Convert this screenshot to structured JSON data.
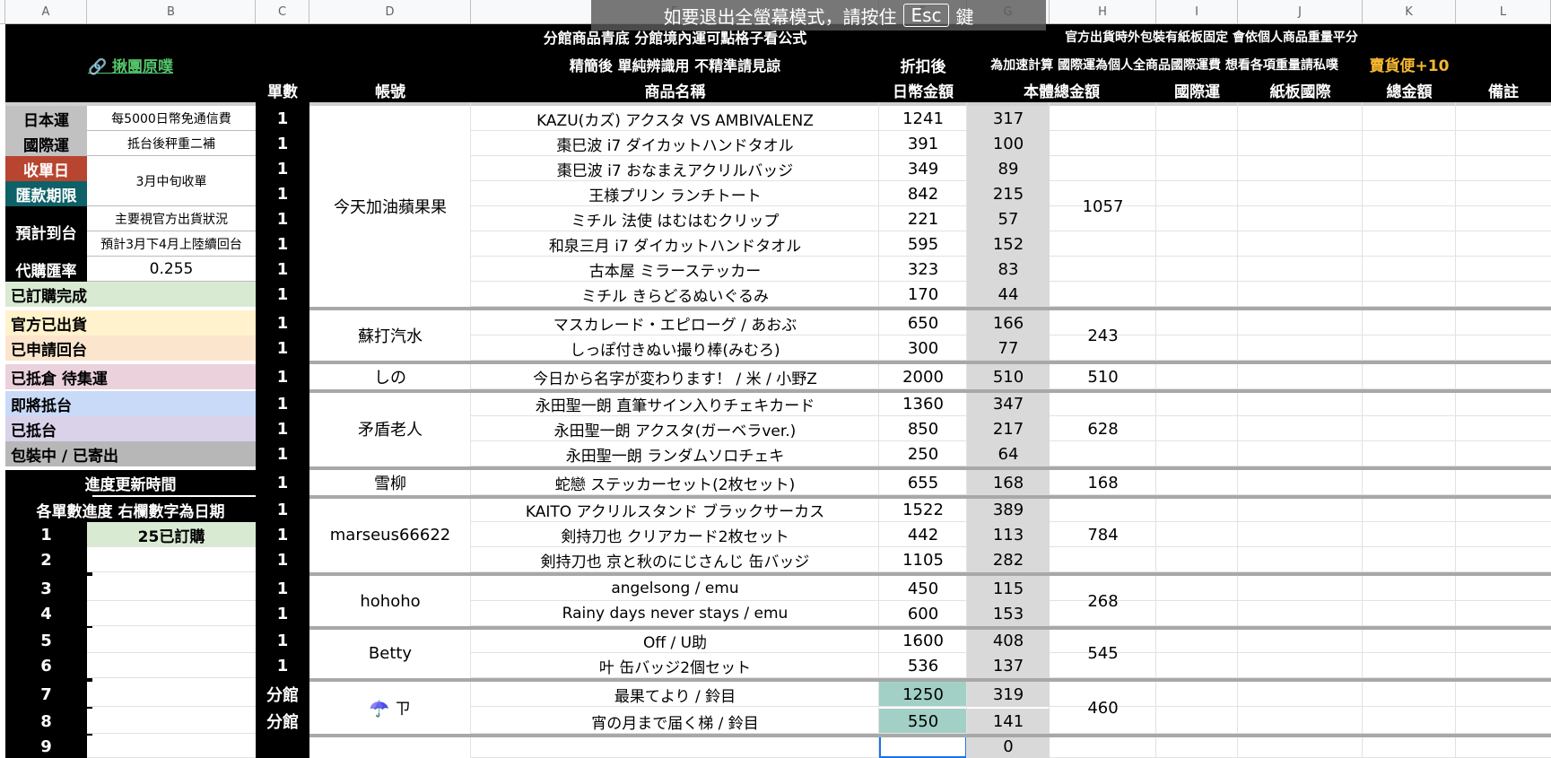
{
  "colors": {
    "nihon": "#c1c1c1",
    "kokusai": "#c1c1c1",
    "shuu": "#b8452f",
    "kikan": "#0d6167",
    "s1": "#d9ead3",
    "s2": "#fff2cc",
    "s3": "#fce5cd",
    "s4": "#ead1dc",
    "s5": "#c9daf8",
    "s6": "#d9d2e9",
    "s7": "#b7b7b7",
    "d_col": "#d9d9d9",
    "teal": "#a2d0c6",
    "yellow": "#f5b731",
    "link": "#54c46b"
  },
  "banner": {
    "text": "如要退出全螢幕模式，請按住",
    "key": "Esc",
    "suffix": "鍵"
  },
  "columns": [
    "A",
    "B",
    "C",
    "D",
    "E",
    "F",
    "G",
    "H",
    "I",
    "J",
    "K",
    "L"
  ],
  "header": {
    "link": "🔗 揪團原噗",
    "row1_mid": "分館商品青底 分館境內運可點格子看公式",
    "row1_right": "官方出貨時外包裝有紙板固定 會依個人商品重量平分",
    "row2_mid": "精簡後 單純辨識用 不精準請見諒",
    "row2_f": "折扣後",
    "row2_right": "為加速計算 國際運為個人全商品國際運費 想看各項重量請私噗",
    "row2_yellow": "賣貨便+10",
    "count": "單數",
    "account": "帳號",
    "product": "商品名稱",
    "jpy": "日幣金額",
    "total": "本體總金額",
    "intl": "國際運",
    "board": "紙板國際",
    "sum": "總金額",
    "note": "備註"
  },
  "info": {
    "r1_label": "日本運",
    "r1_value": "每5000日幣免通信費",
    "r2_label": "國際運",
    "r2_value": "抵台後秤重二補",
    "r3_label": "收單日",
    "r4_label": "匯款期限",
    "r34_value": "3月中旬收單",
    "r56_label": "預計到台",
    "r5_value": "主要視官方出貨狀況",
    "r6_value": "預計3月下4月上陸續回台",
    "r7_label": "代購匯率",
    "r7_value": "0.255"
  },
  "status": [
    "已訂購完成",
    "官方已出貨",
    "已申請回台",
    "已抵倉 待集運",
    "即將抵台",
    "已抵台",
    "包裝中 / 已寄出"
  ],
  "progress": {
    "title": "進度更新時間",
    "sub": "各單數進度 右欄數字為日期",
    "rows": [
      {
        "n": "1",
        "v": "25已訂購"
      },
      {
        "n": "2",
        "v": ""
      },
      {
        "n": "3",
        "v": ""
      },
      {
        "n": "4",
        "v": ""
      },
      {
        "n": "5",
        "v": ""
      },
      {
        "n": "6",
        "v": ""
      },
      {
        "n": "7",
        "v": ""
      },
      {
        "n": "8",
        "v": ""
      },
      {
        "n": "9",
        "v": ""
      }
    ]
  },
  "items": [
    {
      "c": "1",
      "name": "KAZU(カズ) アクスタ VS AMBIVALENZ",
      "jpy": "1241",
      "f": "317"
    },
    {
      "c": "1",
      "name": "棗巳波 i7 ダイカットハンドタオル",
      "jpy": "391",
      "f": "100"
    },
    {
      "c": "1",
      "name": "棗巳波 i7 おなまえアクリルバッジ",
      "jpy": "349",
      "f": "89"
    },
    {
      "c": "1",
      "name": "王様プリン ランチトート",
      "jpy": "842",
      "f": "215"
    },
    {
      "c": "1",
      "name": "ミチル 法使 はむはむクリップ",
      "jpy": "221",
      "f": "57"
    },
    {
      "c": "1",
      "name": "和泉三月 i7 ダイカットハンドタオル",
      "jpy": "595",
      "f": "152"
    },
    {
      "c": "1",
      "name": "古本屋 ミラーステッカー",
      "jpy": "323",
      "f": "83"
    },
    {
      "c": "1",
      "name": "ミチル きらどるぬいぐるみ",
      "jpy": "170",
      "f": "44"
    },
    {
      "c": "1",
      "name": "マスカレード・エピローグ / あおぶ",
      "jpy": "650",
      "f": "166"
    },
    {
      "c": "1",
      "name": "しっぽ付きぬい撮り棒(みむろ)",
      "jpy": "300",
      "f": "77"
    },
    {
      "c": "1",
      "name": "今日から名字が変わります！ / 米 / 小野Z",
      "jpy": "2000",
      "f": "510"
    },
    {
      "c": "1",
      "name": "永田聖一朗 直筆サイン入りチェキカード",
      "jpy": "1360",
      "f": "347"
    },
    {
      "c": "1",
      "name": "永田聖一朗 アクスタ(ガーベラver.)",
      "jpy": "850",
      "f": "217"
    },
    {
      "c": "1",
      "name": "永田聖一朗 ランダムソロチェキ",
      "jpy": "250",
      "f": "64"
    },
    {
      "c": "1",
      "name": "蛇戀 ステッカーセット(2枚セット)",
      "jpy": "655",
      "f": "168"
    },
    {
      "c": "1",
      "name": "KAITO アクリルスタンド ブラックサーカス",
      "jpy": "1522",
      "f": "389"
    },
    {
      "c": "1",
      "name": "剣持刀也 クリアカード2枚セット",
      "jpy": "442",
      "f": "113"
    },
    {
      "c": "1",
      "name": "剣持刀也  京と秋のにじさんじ 缶バッジ",
      "jpy": "1105",
      "f": "282"
    },
    {
      "c": "1",
      "name": "angelsong / emu",
      "jpy": "450",
      "f": "115"
    },
    {
      "c": "1",
      "name": "Rainy days never stays / emu",
      "jpy": "600",
      "f": "153"
    },
    {
      "c": "1",
      "name": "Off / U助",
      "jpy": "1600",
      "f": "408"
    },
    {
      "c": "1",
      "name": "叶 缶バッジ2個セット",
      "jpy": "536",
      "f": "137"
    },
    {
      "c": "分館",
      "name": "最果てより / 鈴目",
      "jpy": "1250",
      "f": "319"
    },
    {
      "c": "分館",
      "name": "宵の月まで届く梯 / 鈴目",
      "jpy": "550",
      "f": "141"
    },
    {
      "c": "",
      "name": "",
      "jpy": "",
      "f": "0"
    }
  ],
  "groups": [
    {
      "account": "今天加油蘋果果",
      "total": "1057"
    },
    {
      "account": "蘇打汽水",
      "total": "243"
    },
    {
      "account": "しの",
      "total": "510"
    },
    {
      "account": "矛盾老人",
      "total": "628"
    },
    {
      "account": "雪柳",
      "total": "168"
    },
    {
      "account": "marseus66622",
      "total": "784"
    },
    {
      "account": "hohoho",
      "total": "268"
    },
    {
      "account": "Betty",
      "total": "545"
    },
    {
      "account": "☂️ ㄗ",
      "total": "460"
    }
  ]
}
